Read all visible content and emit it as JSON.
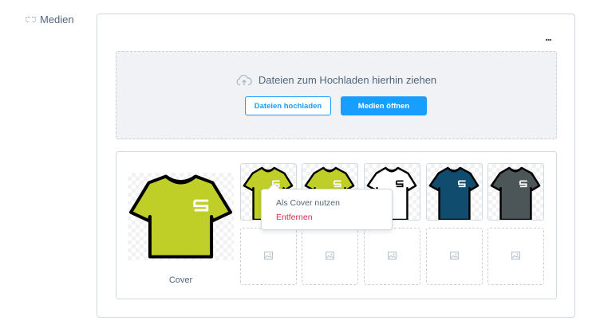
{
  "section": {
    "label": "Medien",
    "icon": "media-link-icon"
  },
  "card": {
    "more_label": "...",
    "more_icon": "more-dots-icon"
  },
  "dropzone": {
    "icon": "cloud-upload-icon",
    "text": "Dateien zum Hochladen hierhin ziehen",
    "upload_button": "Dateien hochladen",
    "open_media_button": "Medien öffnen"
  },
  "colors": {
    "accent": "#189eff",
    "danger": "#de294c",
    "lime": "#c0ce28",
    "navy": "#0f4c6e",
    "slate": "#4c5659",
    "outline": "#000000"
  },
  "gallery": {
    "cover_label": "Cover",
    "cover_color": "lime",
    "thumbnails": [
      {
        "color": "lime"
      },
      {
        "color": "lime"
      },
      {
        "color": "white"
      },
      {
        "color": "navy"
      },
      {
        "color": "slate"
      }
    ],
    "empty_slots": 5,
    "empty_slot_icon": "image-placeholder-icon"
  },
  "context_menu": {
    "items": [
      {
        "label": "Als Cover nutzen",
        "type": "normal"
      },
      {
        "label": "Entfernen",
        "type": "danger"
      }
    ]
  }
}
